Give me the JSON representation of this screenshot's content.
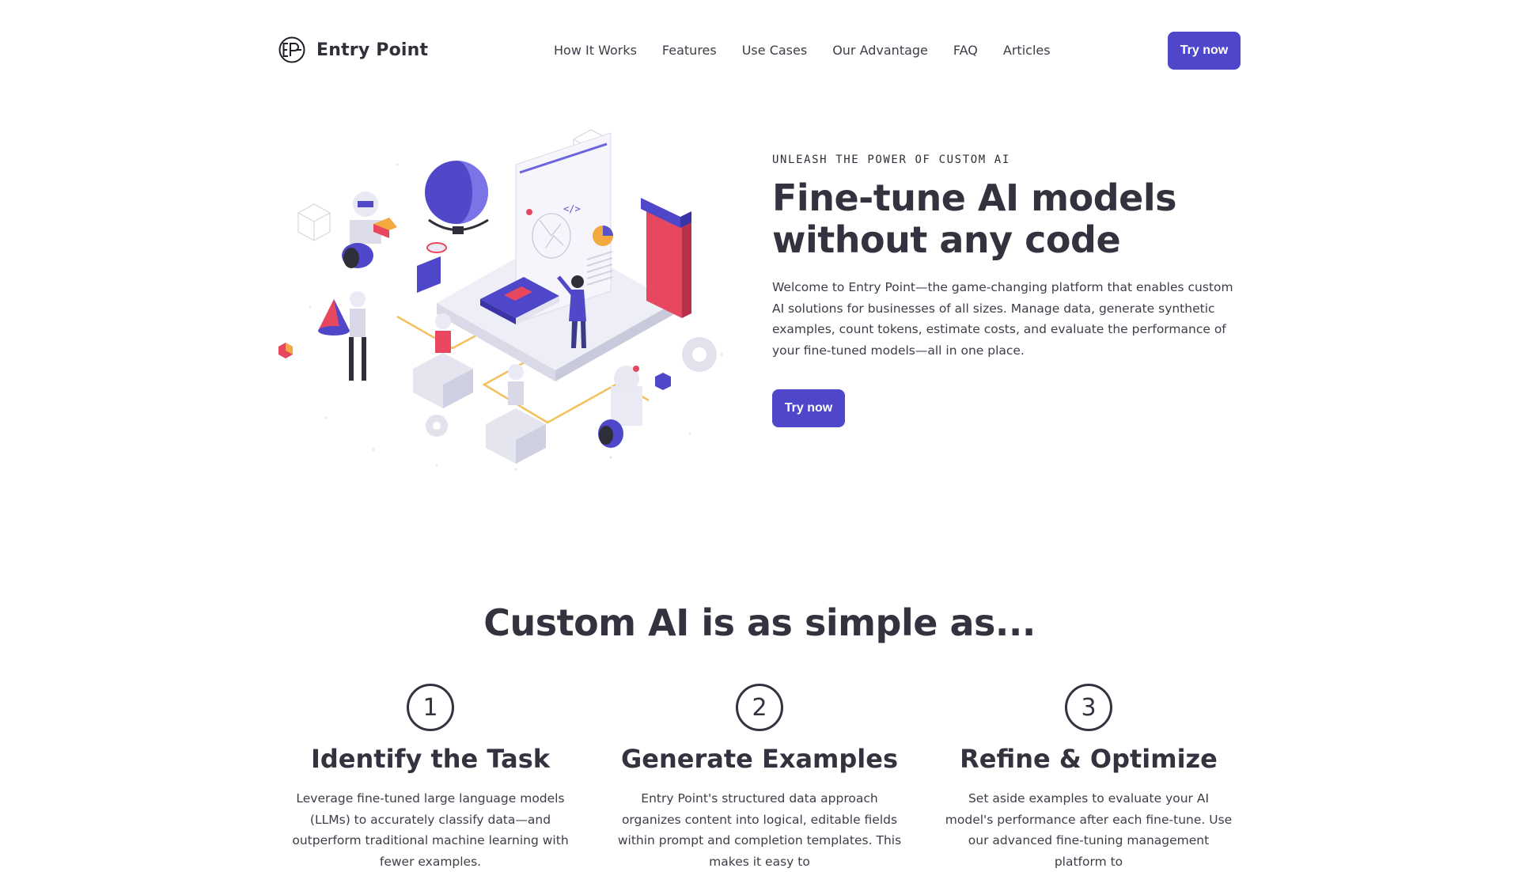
{
  "brand": {
    "name": "Entry Point",
    "logo_icon": "ep-monogram-icon",
    "accent": "#4e47c9"
  },
  "nav": {
    "items": [
      "How It Works",
      "Features",
      "Use Cases",
      "Our Advantage",
      "FAQ",
      "Articles"
    ],
    "cta_label": "Try now"
  },
  "hero": {
    "eyebrow": "UNLEASH THE POWER OF CUSTOM AI",
    "title_line1": "Fine-tune AI models",
    "title_line2": "without any code",
    "description": "Welcome to Entry Point—the game-changing platform that enables custom AI solutions for businesses of all sizes. Manage data, generate synthetic examples, count tokens, estimate costs, and evaluate the performance of your fine-tuned models—all in one place.",
    "cta_label": "Try now",
    "illustration_icon": "isometric-ai-workflow-illustration"
  },
  "steps_section": {
    "title": "Custom AI is as simple as...",
    "steps": [
      {
        "number": "1",
        "title": "Identify the Task",
        "description": "Leverage fine-tuned large language models (LLMs) to accurately classify data—and outperform traditional machine learning with fewer examples."
      },
      {
        "number": "2",
        "title": "Generate Examples",
        "description": "Entry Point's structured data approach organizes content into logical, editable fields within prompt and completion templates. This makes it easy to"
      },
      {
        "number": "3",
        "title": "Refine & Optimize",
        "description": "Set aside examples to evaluate your AI model's performance after each fine-tune. Use our advanced fine-tuning management platform to"
      }
    ]
  }
}
